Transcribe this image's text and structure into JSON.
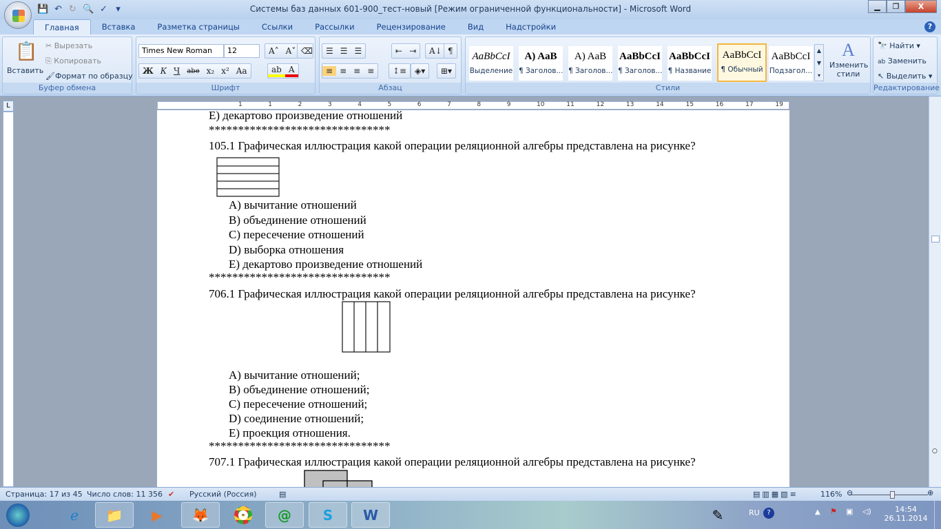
{
  "window": {
    "title": "Системы баз данных 601-900_тест-новый [Режим ограниченной функциональности] - Microsoft Word",
    "minimize": "▁",
    "restore": "❐",
    "close": "X"
  },
  "tabs": [
    "Главная",
    "Вставка",
    "Разметка страницы",
    "Ссылки",
    "Рассылки",
    "Рецензирование",
    "Вид",
    "Надстройки"
  ],
  "ribbon": {
    "clipboard": {
      "label": "Буфер обмена",
      "paste": "Вставить",
      "cut": "Вырезать",
      "copy": "Копировать",
      "format_painter": "Формат по образцу"
    },
    "font": {
      "label": "Шрифт",
      "font_name": "Times New Roman",
      "font_size": "12",
      "buttons": [
        "Ж",
        "К",
        "Ч",
        "abe",
        "x₂",
        "x²",
        "Aa"
      ]
    },
    "paragraph": {
      "label": "Абзац"
    },
    "styles": {
      "label": "Стили",
      "items": [
        {
          "sample": "AaBbCcI",
          "name": "Выделение"
        },
        {
          "sample": "A)  AaB",
          "name": "¶ Заголов..."
        },
        {
          "sample": "A)  AaB",
          "name": "¶ Заголов..."
        },
        {
          "sample": "AaBbCcI",
          "name": "¶ Заголов..."
        },
        {
          "sample": "AaBbCcI",
          "name": "¶ Название"
        },
        {
          "sample": "AaBbCcI",
          "name": "¶ Обычный",
          "selected": true
        },
        {
          "sample": "AaBbCcI",
          "name": "Подзагол..."
        }
      ],
      "change_styles": "Изменить стили"
    },
    "editing": {
      "label": "Редактирование",
      "find": "Найти",
      "replace": "Заменить",
      "select": "Выделить"
    }
  },
  "ruler": {
    "numbers": [
      "1",
      "1",
      "2",
      "3",
      "4",
      "5",
      "6",
      "7",
      "8",
      "9",
      "10",
      "11",
      "12",
      "13",
      "14",
      "15",
      "16",
      "17",
      "19"
    ]
  },
  "document": {
    "lines": [
      "E) декартово произведение отношений",
      "*******************************",
      "105.1 Графическая иллюстрация какой операции реляционной алгебры представлена на рисунке?",
      "A) вычитание отношений",
      "B) объединение отношений",
      "C) пересечение отношений",
      "D) выборка отношения",
      "E) декартово произведение отношений",
      "*******************************",
      "706.1 Графическая иллюстрация какой операции реляционной алгебры представлена на рисунке?",
      "A) вычитание отношений;",
      "B) объединение отношений;",
      "C) пересечение отношений;",
      "D) соединение отношений;",
      "E) проекция отношения.",
      "*******************************",
      "707.1 Графическая иллюстрация какой операции реляционной алгебры представлена на рисунке?"
    ]
  },
  "statusbar": {
    "page": "Страница: 17 из 45",
    "words": "Число слов: 11 356",
    "language": "Русский (Россия)",
    "zoom": "116%"
  },
  "taskbar": {
    "lang": "RU",
    "time": "14:54",
    "date": "26.11.2014",
    "apps": [
      "start",
      "internet-explorer",
      "explorer",
      "media-player",
      "firefox",
      "chrome",
      "mail-agent",
      "skype",
      "word"
    ]
  }
}
